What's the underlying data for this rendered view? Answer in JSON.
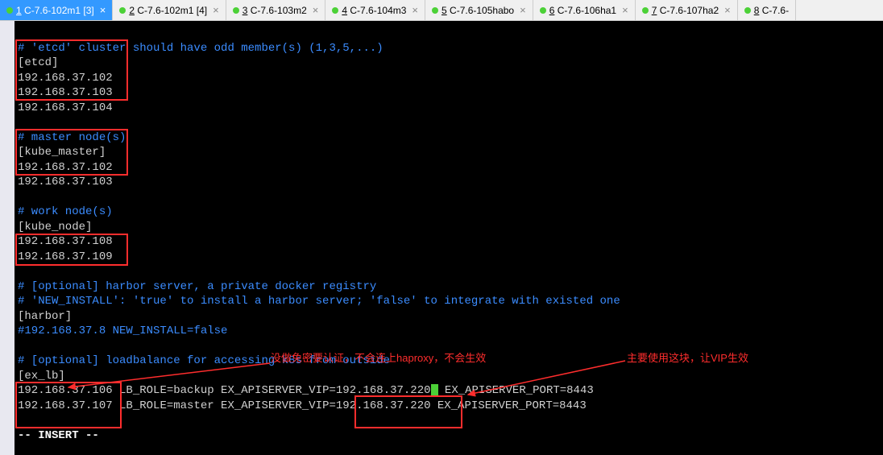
{
  "tabs": [
    {
      "num": "1",
      "label": "C-7.6-102m1 [3]",
      "active": true
    },
    {
      "num": "2",
      "label": "C-7.6-102m1 [4]",
      "active": false
    },
    {
      "num": "3",
      "label": "C-7.6-103m2",
      "active": false
    },
    {
      "num": "4",
      "label": "C-7.6-104m3",
      "active": false
    },
    {
      "num": "5",
      "label": "C-7.6-105habo",
      "active": false
    },
    {
      "num": "6",
      "label": "C-7.6-106ha1",
      "active": false
    },
    {
      "num": "7",
      "label": "C-7.6-107ha2",
      "active": false
    },
    {
      "num": "8",
      "label": "C-7.6-",
      "active": false
    }
  ],
  "lines": {
    "l1": "# 'etcd' cluster should have odd member(s) (1,3,5,...)",
    "l2": "[etcd]",
    "l3": "192.168.37.102",
    "l4": "192.168.37.103",
    "l5": "192.168.37.104",
    "l6": "",
    "l7": "# master node(s)",
    "l8": "[kube_master]",
    "l9": "192.168.37.102",
    "l10": "192.168.37.103",
    "l11": "",
    "l12": "# work node(s)",
    "l13": "[kube_node]",
    "l14": "192.168.37.108",
    "l15": "192.168.37.109",
    "l16": "",
    "l17": "# [optional] harbor server, a private docker registry",
    "l18": "# 'NEW_INSTALL': 'true' to install a harbor server; 'false' to integrate with existed one",
    "l19": "[harbor]",
    "l20": "#192.168.37.8 NEW_INSTALL=false",
    "l21": "",
    "l22": "# [optional] loadbalance for accessing k8s from outside",
    "l23": "[ex_lb]",
    "l24a": "192.168.37.106 ",
    "l24b": "LB_ROLE=backup EX_APISERVER_VIP",
    "l24c": "=192.168.37.220",
    "l24d": " EX_APISERVER_PORT=8443",
    "l25a": "192.168.37.107 ",
    "l25b": "LB_ROLE=master EX_APISERVER_VIP",
    "l25c": "=192.168.37.220 ",
    "l25d": "EX_APISERVER_PORT=8443",
    "l26": "",
    "l27": "-- INSERT --"
  },
  "annotations": {
    "a1": "没做免密要认证，不会连上haproxy，不会生效",
    "a2": "主要使用这块，让VIP生效"
  }
}
